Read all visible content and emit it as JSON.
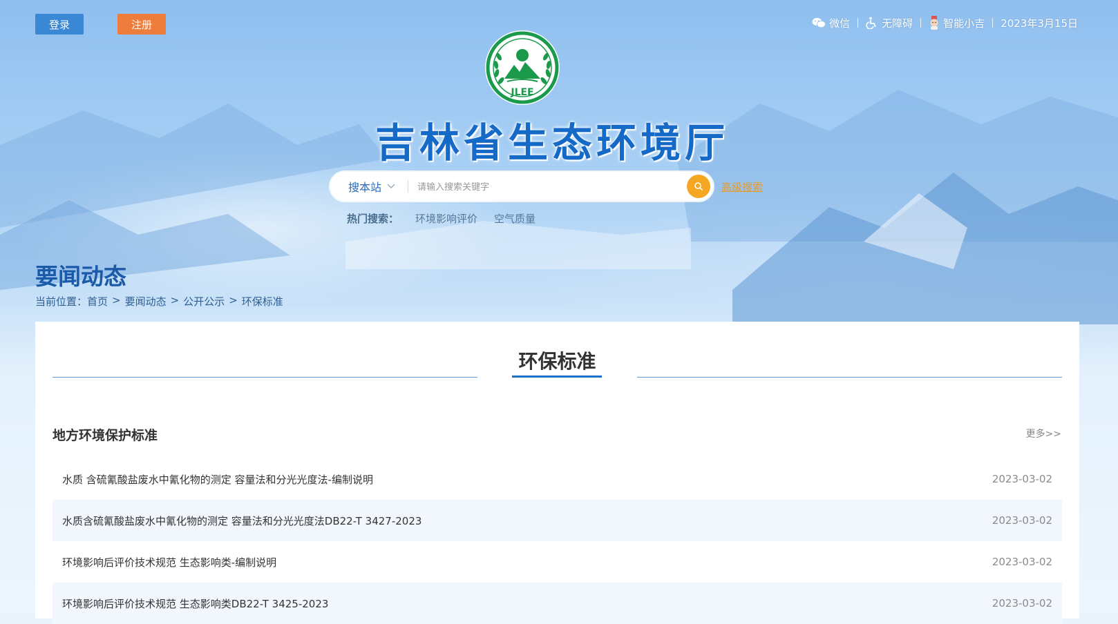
{
  "auth": {
    "login_label": "登录",
    "register_label": "注册"
  },
  "topbar": {
    "wechat_label": "微信",
    "accessibility_label": "无障碍",
    "assistant_label": "智能小吉",
    "date": "2023年3月15日"
  },
  "logo": {
    "text": "JLEE"
  },
  "site_title": "吉林省生态环境厅",
  "search": {
    "scope_label": "搜本站",
    "placeholder": "请输入搜索关键字",
    "advanced_label": "高级搜索",
    "hot_label": "热门搜索：",
    "hot_links": [
      "环境影响评价",
      "空气质量"
    ]
  },
  "section": {
    "title": "要闻动态",
    "breadcrumb": [
      "当前位置：首页",
      ">",
      "要闻动态",
      ">",
      "公开公示",
      ">",
      "环保标准"
    ]
  },
  "panel": {
    "title": "环保标准",
    "subsection_title": "地方环境保护标准",
    "more_label": "更多>>",
    "items": [
      {
        "title": "水质 含硫氰酸盐废水中氰化物的测定 容量法和分光光度法-编制说明",
        "date": "2023-03-02"
      },
      {
        "title": "水质含硫氰酸盐废水中氰化物的测定 容量法和分光光度法DB22-T 3427-2023",
        "date": "2023-03-02"
      },
      {
        "title": "环境影响后评价技术规范 生态影响类-编制说明",
        "date": "2023-03-02"
      },
      {
        "title": "环境影响后评价技术规范 生态影响类DB22-T 3425-2023",
        "date": "2023-03-02"
      }
    ]
  },
  "colors": {
    "accent_blue": "#1569c7",
    "login_bg": "#3a87d6",
    "register_bg": "#ee7d3d",
    "search_button": "#f5a623",
    "logo_green": "#1a9a4a"
  }
}
